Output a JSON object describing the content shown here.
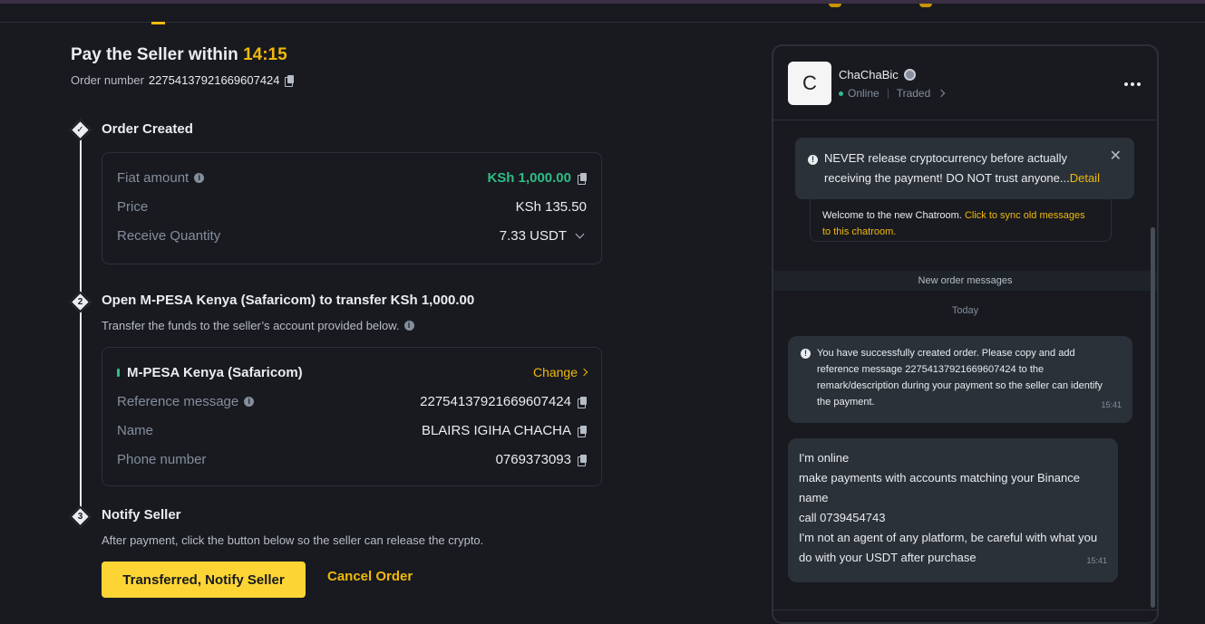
{
  "header": {
    "title_prefix": "Pay the Seller within",
    "timer": "14:15",
    "order_label": "Order number",
    "order_number": "22754137921669607424"
  },
  "steps": [
    {
      "num": "✓",
      "title": "Order Created"
    },
    {
      "num": "2",
      "title": "Open M-PESA Kenya (Safaricom) to transfer KSh 1,000.00",
      "desc": "Transfer the funds to the seller’s account provided below."
    },
    {
      "num": "3",
      "title": "Notify Seller",
      "desc": "After payment, click the button below so the seller can release the crypto."
    }
  ],
  "order_details": {
    "fiat_label": "Fiat amount",
    "fiat_value": "KSh 1,000.00",
    "price_label": "Price",
    "price_value": "KSh 135.50",
    "qty_label": "Receive Quantity",
    "qty_value": "7.33 USDT"
  },
  "payment": {
    "method": "M-PESA Kenya (Safaricom)",
    "change_label": "Change",
    "ref_label": "Reference message",
    "ref_value": "22754137921669607424",
    "name_label": "Name",
    "name_value": "BLAIRS IGIHA CHACHA",
    "phone_label": "Phone number",
    "phone_value": "0769373093"
  },
  "actions": {
    "notify_label": "Transferred, Notify Seller",
    "cancel_label": "Cancel Order"
  },
  "chat": {
    "avatar_letter": "C",
    "seller_name": "ChaChaBic",
    "status": "Online",
    "traded_label": "Traded",
    "warning_text": "NEVER release cryptocurrency before actually receiving the payment! DO NOT trust anyone...",
    "warning_detail": "Detail",
    "sync_text": "Welcome to the new Chatroom.",
    "sync_link": "Click to sync old messages to this chatroom.",
    "new_messages_label": "New order messages",
    "today_label": "Today",
    "system_message": "You have successfully created order. Please copy and add reference message 22754137921669607424 to the remark/description during your payment so the seller can identify the payment.",
    "system_time": "15:41",
    "user_message_lines": [
      "I'm online",
      "make payments with accounts matching your Binance name",
      "call 0739454743",
      "I'm not an agent of any platform, be careful with what you do with your USDT after purchase"
    ],
    "user_time": "15:41"
  },
  "colors": {
    "accent": "#f0b90b",
    "primary_button": "#fcd535",
    "success": "#2ebd85",
    "background": "#181a20"
  }
}
